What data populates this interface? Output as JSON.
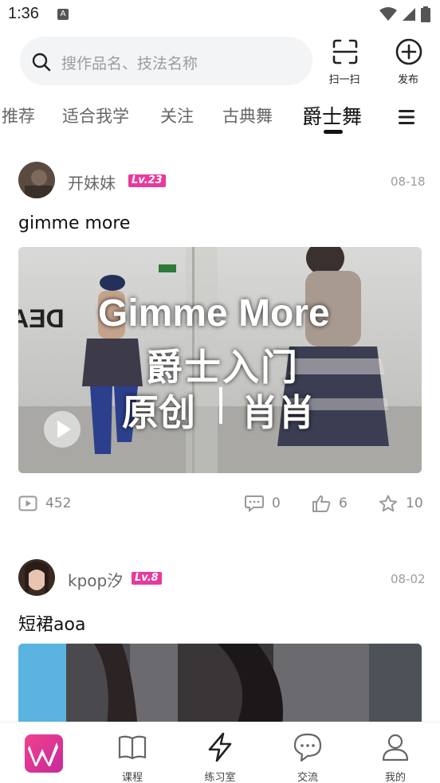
{
  "status_bar": {
    "time": "1:36",
    "notification_icon": "A"
  },
  "header": {
    "search_placeholder": "搜作品名、技法名称",
    "scan_label": "扫一扫",
    "publish_label": "发布"
  },
  "tabs": [
    {
      "label": "推荐",
      "active": false
    },
    {
      "label": "适合我学",
      "active": false
    },
    {
      "label": "关注",
      "active": false
    },
    {
      "label": "古典舞",
      "active": false
    },
    {
      "label": "爵士舞",
      "active": true
    }
  ],
  "posts": [
    {
      "user": "开妹妹",
      "level": "Lv.23",
      "date": "08-18",
      "title": "gimme more",
      "thumbnail": {
        "studio_sign": "DEA",
        "overlay_line1": "Gimme More",
        "overlay_line2": "爵士入门",
        "overlay_line3a": "原创",
        "overlay_line3b": "肖肖"
      },
      "stats": {
        "views": "452",
        "comments": "0",
        "likes": "6",
        "favorites": "10"
      }
    },
    {
      "user": "kpop汐",
      "level": "Lv.8",
      "date": "08-02",
      "title": "短裙aoa"
    }
  ],
  "bottom_nav": [
    {
      "label": "",
      "icon": "app-logo-icon"
    },
    {
      "label": "课程",
      "icon": "book-icon"
    },
    {
      "label": "练习室",
      "icon": "lightning-icon"
    },
    {
      "label": "交流",
      "icon": "chat-icon"
    },
    {
      "label": "我的",
      "icon": "user-icon"
    }
  ],
  "colors": {
    "level_badge": "#e9399c",
    "accent": "#e9399c"
  }
}
